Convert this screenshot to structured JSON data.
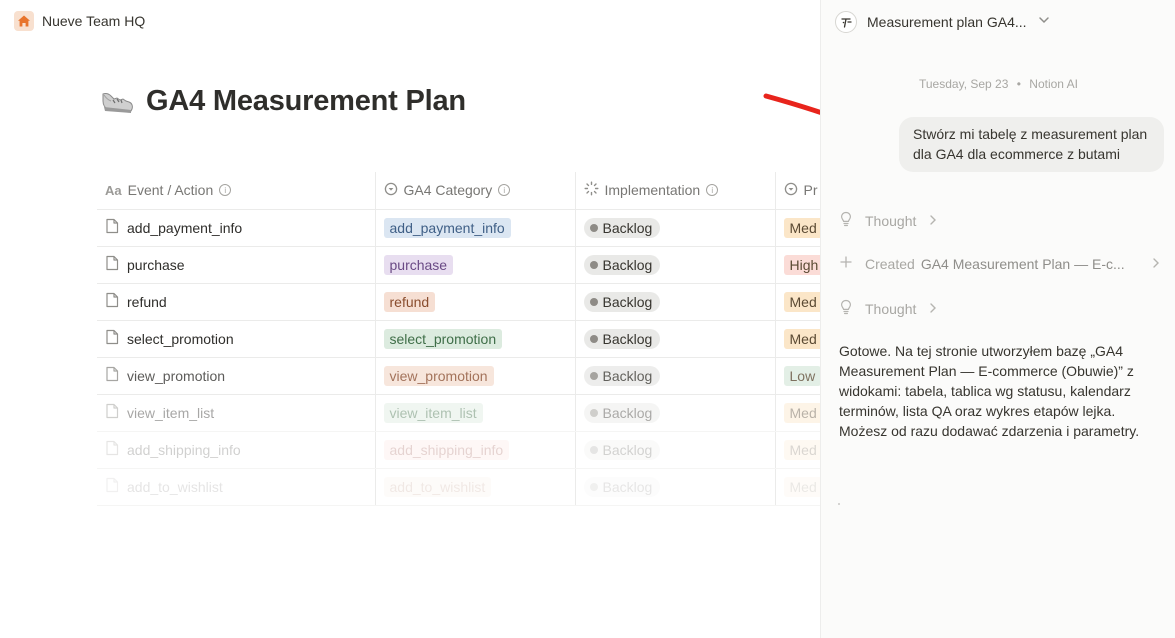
{
  "workspace": {
    "name": "Nueve Team HQ",
    "icon": "home-icon",
    "icon_color": "#e8742c"
  },
  "page": {
    "title": "GA4 Measurement Plan",
    "emoji": "sneaker-emoji"
  },
  "table": {
    "columns": [
      {
        "label": "Event / Action",
        "icon": "text-property-icon"
      },
      {
        "label": "GA4 Category",
        "icon": "select-property-icon"
      },
      {
        "label": "Implementation",
        "icon": "status-property-icon"
      },
      {
        "label": "Pr",
        "icon": "select-property-icon"
      }
    ],
    "rows": [
      {
        "event": "add_payment_info",
        "category": "add_payment_info",
        "category_color": "#dbe6f2",
        "category_text": "#3f5f86",
        "status": "Backlog",
        "priority": "Med",
        "priority_color": "#fbe6c8"
      },
      {
        "event": "purchase",
        "category": "purchase",
        "category_color": "#e8def0",
        "category_text": "#6a4a85",
        "status": "Backlog",
        "priority": "High",
        "priority_color": "#fbdcd7"
      },
      {
        "event": "refund",
        "category": "refund",
        "category_color": "#f6dfd3",
        "category_text": "#8a4d2e",
        "status": "Backlog",
        "priority": "Med",
        "priority_color": "#fbe6c8"
      },
      {
        "event": "select_promotion",
        "category": "select_promotion",
        "category_color": "#dcebdf",
        "category_text": "#3f6e48",
        "status": "Backlog",
        "priority": "Med",
        "priority_color": "#fbe6c8"
      },
      {
        "event": "view_promotion",
        "category": "view_promotion",
        "category_color": "#f6dfd3",
        "category_text": "#8a4d2e",
        "status": "Backlog",
        "priority": "Low",
        "priority_color": "#dcebdf"
      },
      {
        "event": "view_item_list",
        "category": "view_item_list",
        "category_color": "#dcebdf",
        "category_text": "#3f6e48",
        "status": "Backlog",
        "priority": "Med",
        "priority_color": "#fbe6c8"
      },
      {
        "event": "add_shipping_info",
        "category": "add_shipping_info",
        "category_color": "#fbdcd7",
        "category_text": "#8e3b32",
        "status": "Backlog",
        "priority": "Med",
        "priority_color": "#fbe6c8"
      },
      {
        "event": "add_to_wishlist",
        "category": "add_to_wishlist",
        "category_color": "#f6dfd3",
        "category_text": "#8a4d2e",
        "status": "Backlog",
        "priority": "Med",
        "priority_color": "#fbe6c8"
      }
    ],
    "info_glyph": "i"
  },
  "annotation": {
    "arrow_color": "#e8241c"
  },
  "ai_panel": {
    "title": "Measurement plan GA4...",
    "meta_date": "Tuesday, Sep 23",
    "meta_sep": "•",
    "meta_source": "Notion AI",
    "user_message": "Stwórz mi tabelę z measurement plan dla GA4 dla ecommerce z butami",
    "steps": [
      {
        "label": "Thought",
        "icon": "lightbulb-icon"
      },
      {
        "label": "Created",
        "title": "GA4 Measurement Plan — E-c...",
        "icon": "plus-icon"
      },
      {
        "label": "Thought",
        "icon": "lightbulb-icon"
      }
    ],
    "answer": "Gotowe. Na tej stronie utworzyłem bazę „GA4 Measurement Plan — E-commerce (Obuwie)” z widokami: tabela, tablica wg statusu, kalendarz terminów, lista QA oraz wykres etapów lejka. Możesz od razu dodawać zdarzenia i parametry."
  }
}
